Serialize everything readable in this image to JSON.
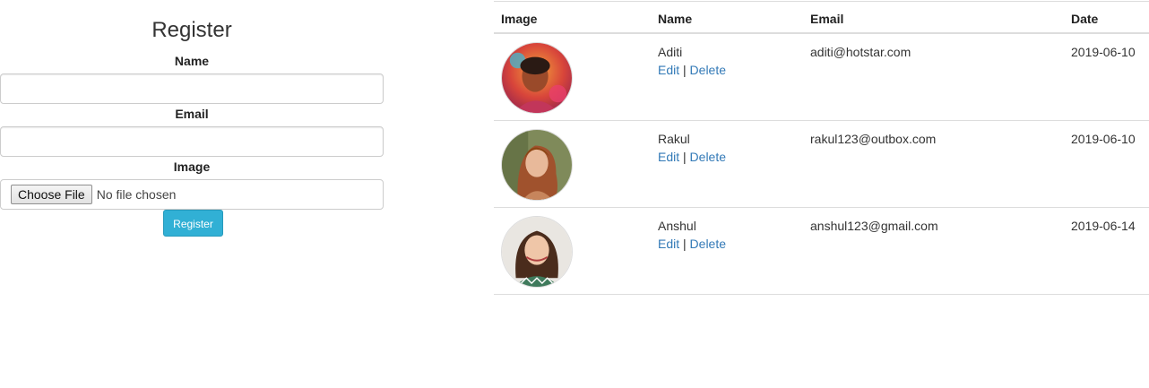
{
  "form": {
    "title": "Register",
    "name_label": "Name",
    "name_value": "",
    "email_label": "Email",
    "email_value": "",
    "image_label": "Image",
    "file_button": "Choose File",
    "file_status": "No file chosen",
    "submit_label": "Register"
  },
  "table": {
    "headers": {
      "image": "Image",
      "name": "Name",
      "email": "Email",
      "date": "Date"
    },
    "rows": [
      {
        "name": "Aditi",
        "email": "aditi@hotstar.com",
        "date": "2019-06-10",
        "edit": "Edit",
        "sep": "|",
        "delete": "Delete"
      },
      {
        "name": "Rakul",
        "email": "rakul123@outbox.com",
        "date": "2019-06-10",
        "edit": "Edit",
        "sep": "|",
        "delete": "Delete"
      },
      {
        "name": "Anshul",
        "email": "anshul123@gmail.com",
        "date": "2019-06-14",
        "edit": "Edit",
        "sep": "|",
        "delete": "Delete"
      }
    ]
  },
  "colors": {
    "link": "#337ab7",
    "button": "#31b0d5",
    "border": "#dddddd"
  }
}
